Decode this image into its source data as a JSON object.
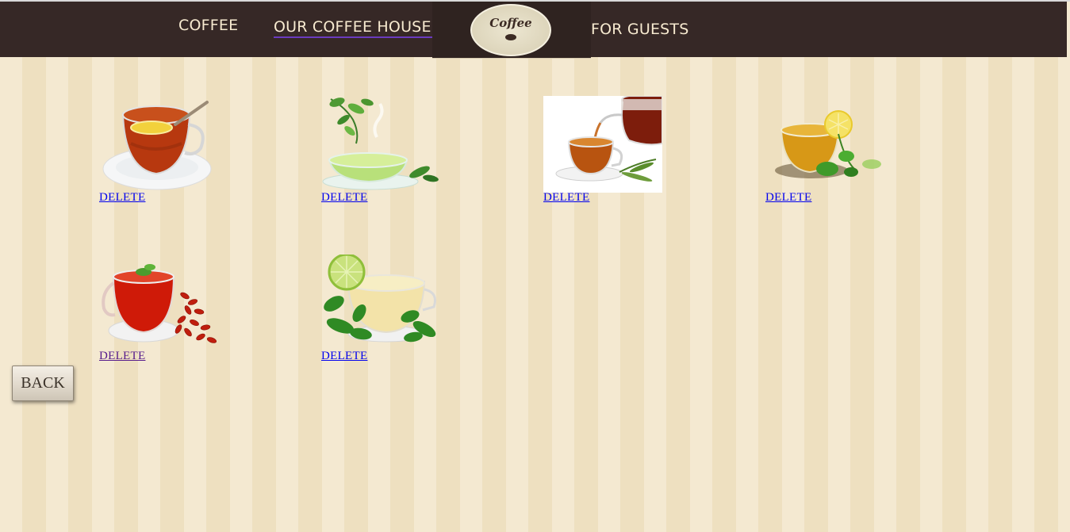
{
  "nav": {
    "items": [
      {
        "label": "COFFEE"
      },
      {
        "label": "OUR COFFEE HOUSE"
      },
      {
        "label": "FOR GUESTS"
      }
    ],
    "logo_text": "Coffee"
  },
  "products": [
    {
      "image": "tea-lemon-cup",
      "action_label": "DELETE"
    },
    {
      "image": "green-tea-leaves",
      "action_label": "DELETE"
    },
    {
      "image": "black-tea-pour",
      "action_label": "DELETE"
    },
    {
      "image": "herbal-tea-lemon-mint",
      "action_label": "DELETE"
    },
    {
      "image": "goji-berry-tea",
      "action_label": "DELETE",
      "visited": true
    },
    {
      "image": "lime-mint-tea",
      "action_label": "DELETE"
    }
  ],
  "back_button": {
    "label": "BACK"
  },
  "colors": {
    "navbar": "#362826",
    "nav_text": "#f7ead0",
    "background": "#f2e5c8",
    "link": "#0000ee",
    "link_visited": "#551a8b"
  }
}
